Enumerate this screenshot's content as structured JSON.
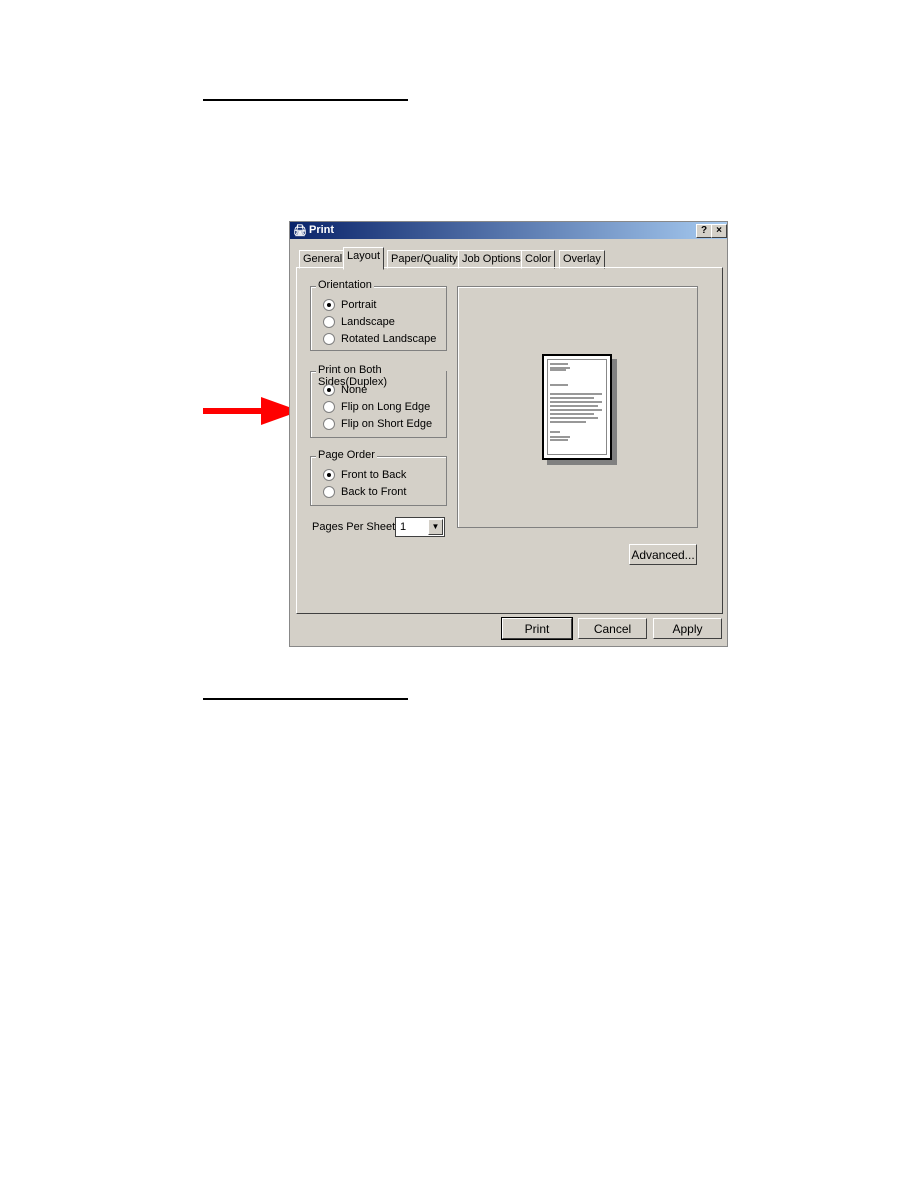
{
  "dialog": {
    "title": "Print",
    "help": "?",
    "close": "×",
    "tabs": [
      "General",
      "Layout",
      "Paper/Quality",
      "Job Options",
      "Color",
      "Overlay"
    ],
    "orientation": {
      "label": "Orientation",
      "options": [
        "Portrait",
        "Landscape",
        "Rotated Landscape"
      ],
      "selected": "Portrait"
    },
    "duplex": {
      "label": "Print on Both Sides(Duplex)",
      "options": [
        "None",
        "Flip on Long Edge",
        "Flip on Short Edge"
      ],
      "selected": "None"
    },
    "page_order": {
      "label": "Page Order",
      "options": [
        "Front to Back",
        "Back to Front"
      ],
      "selected": "Front to Back"
    },
    "pages_per_sheet": {
      "label": "Pages Per Sheet:",
      "value": "1"
    },
    "advanced": "Advanced...",
    "buttons": {
      "print": "Print",
      "cancel": "Cancel",
      "apply": "Apply"
    }
  },
  "colors": {
    "arrow": "#ff0000",
    "titlebar": "#0a246a"
  }
}
